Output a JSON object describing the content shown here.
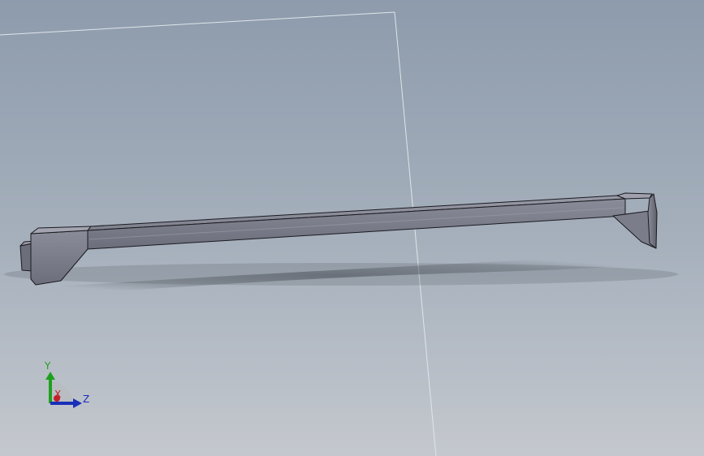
{
  "viewport": {
    "background_top": "#8d9bac",
    "background_bottom": "#c4c8ce",
    "plane_color": "#dfe6ea"
  },
  "model": {
    "description_icon": "bar-part-3d",
    "body_color": "#7d7f8c",
    "edge_color": "#1a1a1f"
  },
  "triad": {
    "y_label": "Y",
    "z_label": "Z",
    "x_label": "X",
    "y_color": "#1ea01e",
    "z_color": "#1a2fb8",
    "x_color": "#c0202a"
  }
}
